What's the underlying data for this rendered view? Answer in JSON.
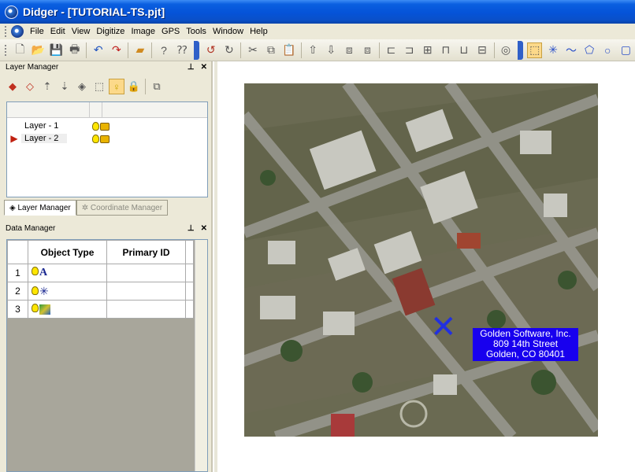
{
  "window": {
    "title": "Didger - [TUTORIAL-TS.pjt]"
  },
  "menu": [
    "File",
    "Edit",
    "View",
    "Digitize",
    "Image",
    "GPS",
    "Tools",
    "Window",
    "Help"
  ],
  "toolbar_icons": [
    "new-icon",
    "open-icon",
    "save-icon",
    "print-icon",
    "undo-icon",
    "redo-icon",
    "bandaid-icon",
    "help-icon",
    "whats-this-icon",
    "undo-arrow-icon",
    "redo-arrow-icon",
    "cut-icon",
    "copy-icon",
    "paste-icon",
    "move-up-icon",
    "move-down-icon",
    "arrange-icon",
    "arrange-icon",
    "align-left-icon",
    "align-right-icon",
    "align-center-icon",
    "align-top-icon",
    "align-bottom-icon",
    "align-middle-icon",
    "overview-icon",
    "select-icon",
    "point-icon",
    "polyline-icon",
    "polygon-icon",
    "circle-icon",
    "rectangle-icon"
  ],
  "layer_manager": {
    "title": "Layer Manager",
    "layers": [
      {
        "name": "Layer - 1",
        "selected": false
      },
      {
        "name": "Layer - 2",
        "selected": true
      }
    ],
    "tabs": [
      "Layer Manager",
      "Coordinate Manager"
    ]
  },
  "data_manager": {
    "title": "Data Manager",
    "columns": [
      "Object Type",
      "Primary ID"
    ],
    "rows": [
      {
        "num": "1",
        "type_icon": "text-icon",
        "type_glyph": "A"
      },
      {
        "num": "2",
        "type_icon": "point-icon",
        "type_glyph": "✳"
      },
      {
        "num": "3",
        "type_icon": "image-icon",
        "type_glyph": ""
      }
    ]
  },
  "map": {
    "label_lines": [
      "Golden Software, Inc.",
      "809 14th Street",
      "Golden, CO 80401"
    ],
    "marker": "✕"
  }
}
